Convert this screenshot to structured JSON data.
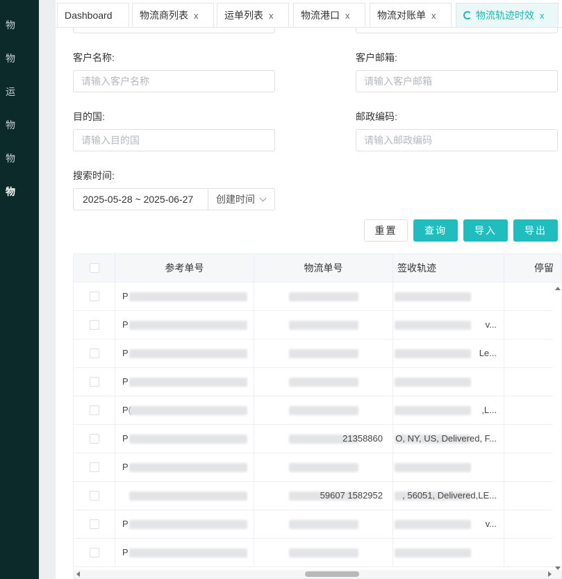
{
  "sidebar": {
    "items": [
      {
        "label": "物"
      },
      {
        "label": "物"
      },
      {
        "label": "运"
      },
      {
        "label": "物"
      },
      {
        "label": "物"
      },
      {
        "label": "物"
      }
    ]
  },
  "tabs": [
    {
      "label": "Dashboard"
    },
    {
      "label": "物流商列表"
    },
    {
      "label": "运单列表"
    },
    {
      "label": "物流港口"
    },
    {
      "label": "物流对账单"
    },
    {
      "label": "物流轨迹时效"
    }
  ],
  "form": {
    "customer_name": {
      "label": "客户名称:",
      "placeholder": "请输入客户名称"
    },
    "customer_email": {
      "label": "客户邮箱:",
      "placeholder": "请输入客户邮箱"
    },
    "destination": {
      "label": "目的国:",
      "placeholder": "请输入目的国"
    },
    "postal_code": {
      "label": "邮政编码:",
      "placeholder": "请输入邮政编码"
    },
    "search_time": {
      "label": "搜索时间:",
      "range": "2025-05-28 ~ 2025-06-27",
      "type": "创建时间"
    }
  },
  "buttons": {
    "reset": "重置",
    "query": "查询",
    "import": "导入",
    "export": "导出"
  },
  "table": {
    "columns": [
      "参考单号",
      "物流单号",
      "签收轨迹",
      "停留"
    ],
    "rows": [
      {
        "ref": "P",
        "tracking": "",
        "track": ""
      },
      {
        "ref": "P",
        "tracking": "",
        "track": "v..."
      },
      {
        "ref": "P",
        "tracking": "",
        "track": "Le..."
      },
      {
        "ref": "P",
        "tracking": "",
        "track": ""
      },
      {
        "ref": "P(",
        "tracking": "",
        "track": ",L..."
      },
      {
        "ref": "P",
        "tracking": "21358860",
        "track": "O, NY, US, Delivered, F..."
      },
      {
        "ref": "P",
        "tracking": "",
        "track": ""
      },
      {
        "ref": "",
        "tracking": "59607 1582952",
        "track": ", 56051, Delivered,LE..."
      },
      {
        "ref": "P",
        "tracking": "",
        "track": "v..."
      },
      {
        "ref": "P",
        "tracking": "",
        "track": ""
      }
    ]
  },
  "colors": {
    "sidebar": "#0d2a2a",
    "accent": "#1fbdbd"
  }
}
